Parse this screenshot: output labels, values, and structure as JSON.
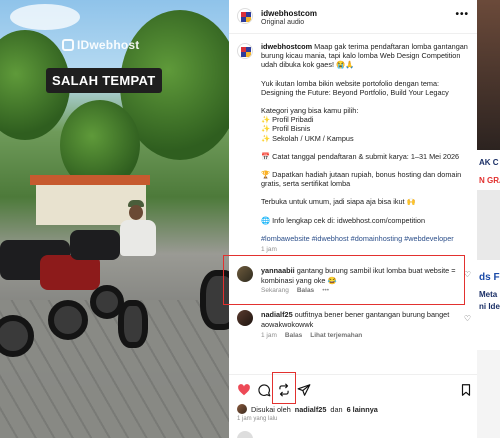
{
  "media": {
    "watermark": "IDwebhost",
    "tag": "SALAH TEMPAT"
  },
  "header": {
    "username": "idwebhostcom",
    "subtitle": "Original audio",
    "more": "•••"
  },
  "caption": {
    "username": "idwebhostcom",
    "p1": "Maap gak terima pendaftaran lomba gantangan burung kicau mania, tapi kalo lomba Web Design Competition udah dibuka kok gaes! 😭🙏",
    "p2a": "Yuk ikutan lomba bikin website portofolio dengan tema:",
    "p2b": "Designing the Future: Beyond Portfolio, Build Your Legacy",
    "p3a": "Kategori yang bisa kamu pilih:",
    "p3b": "✨ Profil Pribadi",
    "p3c": "✨ Profil Bisnis",
    "p3d": "✨ Sekolah / UKM / Kampus",
    "p4": "📅 Catat tanggal pendaftaran & submit karya: 1–31 Mei 2026",
    "p5": "🏆 Dapatkan hadiah jutaan rupiah, bonus hosting dan domain gratis, serta sertifikat lomba",
    "p6": "Terbuka untuk umum, jadi siapa aja bisa ikut 🙌",
    "p7": "🌐 Info lengkap cek di: idwebhost.com/competition",
    "hashtags": "#lombawebsite #idwebhost #domainhosting #webdeveloper",
    "time": "1 jam"
  },
  "comments": [
    {
      "username": "yannaabii",
      "text": " gantang burung sambil ikut lomba buat website = kombinasi yang oke 😂",
      "time": "Sekarang",
      "reply": "Balas",
      "more": "•••"
    },
    {
      "username": "nadialf25",
      "text": " outfitnya bener bener gantangan burung banget aowakwokowwk",
      "time": "1 jam",
      "reply": "Balas",
      "translate": "Lihat terjemahan"
    }
  ],
  "actions": {
    "liked_by_prefix": "Disukai oleh",
    "liked_by_user": "nadialf25",
    "liked_by_and": "dan",
    "liked_by_others": "6 lainnya",
    "post_time": "1 jam yang lalu"
  },
  "right_strip": {
    "line1": "AK C",
    "line2": "N GRA",
    "line3": "ds F",
    "line4": "Meta",
    "line5": "ni Ide"
  },
  "colors": {
    "like_red": "#ed4956",
    "highlight_red": "#e2312f",
    "hashtag_blue": "#2c4f8a"
  }
}
